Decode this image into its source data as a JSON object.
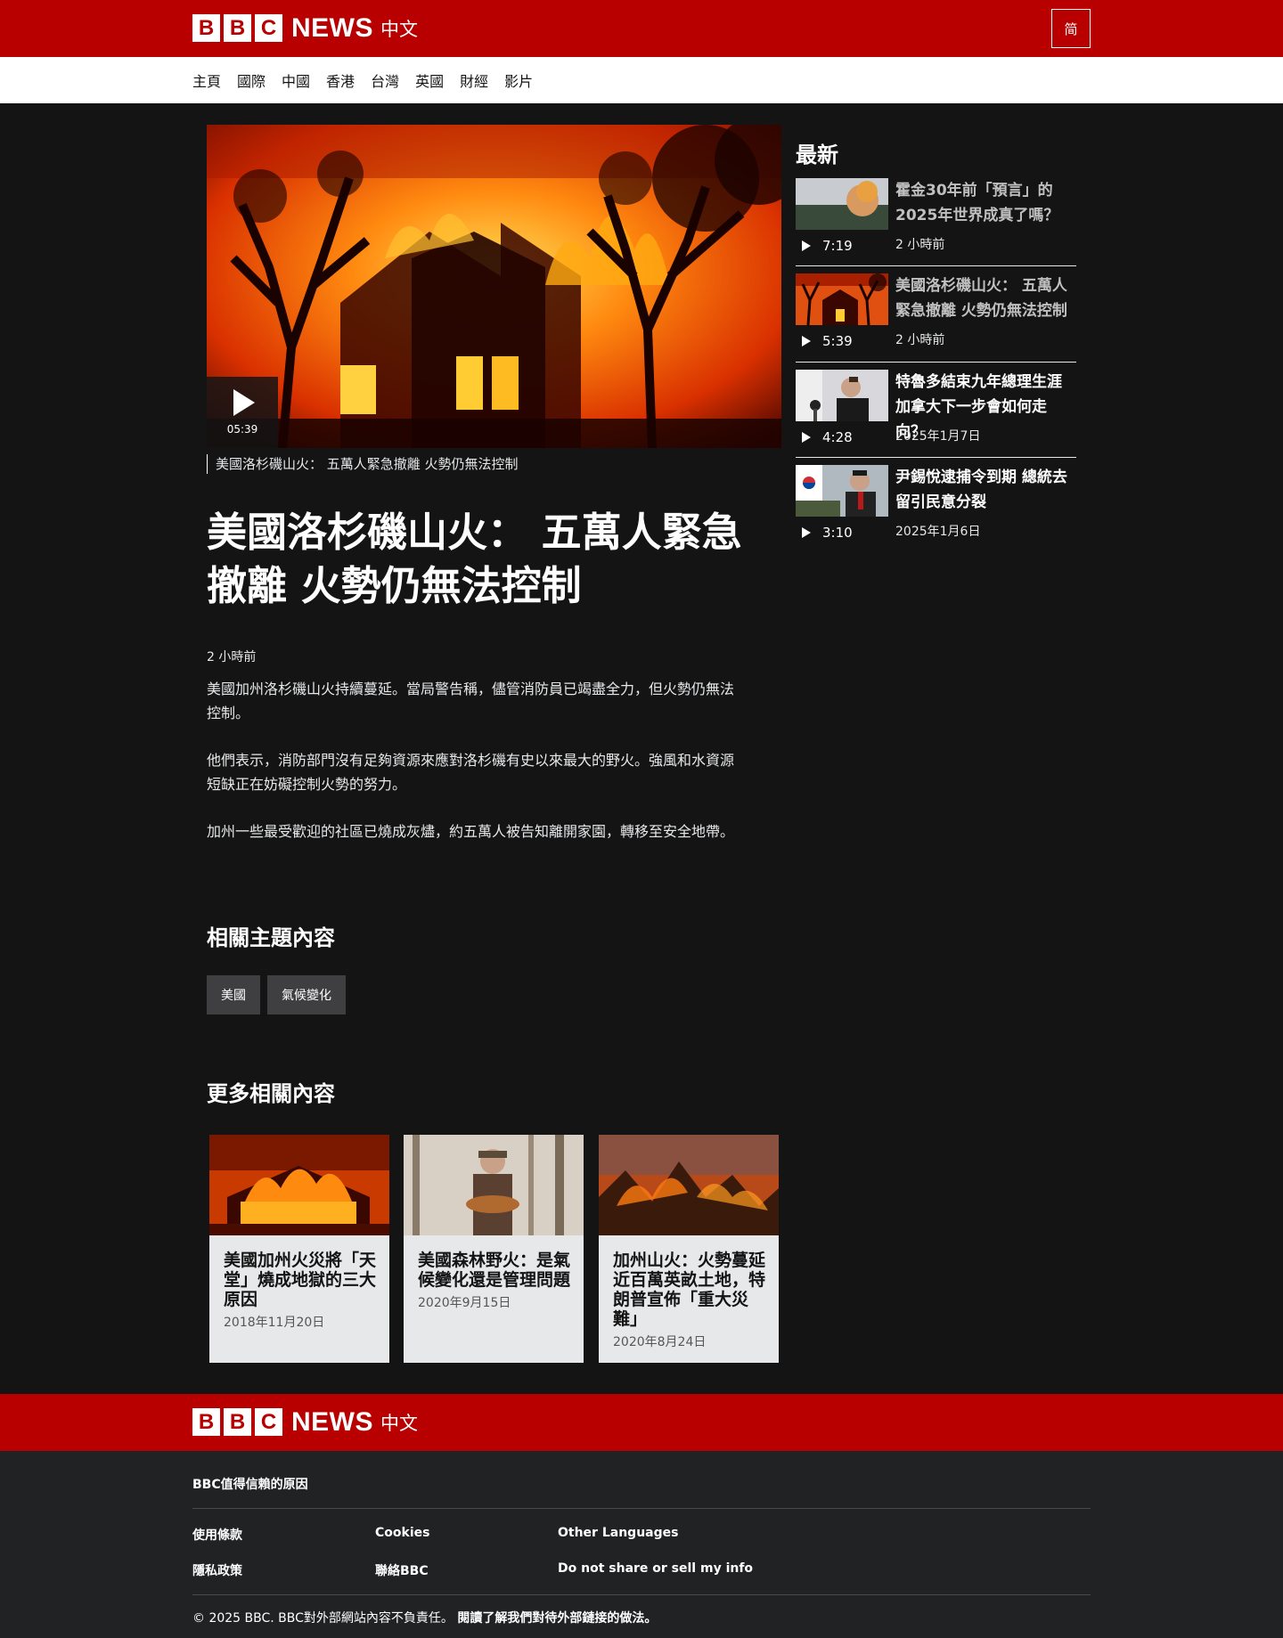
{
  "header": {
    "logo_letters": [
      "B",
      "B",
      "C"
    ],
    "logo_news": "NEWS",
    "logo_lang": "中文",
    "lang_toggle": "简"
  },
  "nav": [
    "主頁",
    "國際",
    "中國",
    "香港",
    "台灣",
    "英國",
    "財經",
    "影片"
  ],
  "hero": {
    "duration": "05:39",
    "caption": "美國洛杉磯山火： 五萬人緊急撤離 火勢仍無法控制"
  },
  "article": {
    "headline": "美國洛杉磯山火： 五萬人緊急撤離 火勢仍無法控制",
    "timestamp": "2 小時前",
    "paragraphs": [
      "美國加州洛杉磯山火持續蔓延。當局警告稱，儘管消防員已竭盡全力，但火勢仍無法控制。",
      "他們表示，消防部門沒有足夠資源來應對洛杉磯有史以來最大的野火。強風和水資源短缺正在妨礙控制火勢的努力。",
      "加州一些最受歡迎的社區已燒成灰燼，約五萬人被告知離開家園，轉移至安全地帶。"
    ]
  },
  "topics": {
    "title": "相關主題內容",
    "tags": [
      "美國",
      "氣候變化"
    ]
  },
  "related": {
    "title": "更多相關內容",
    "cards": [
      {
        "title": "美國加州火災將「天堂」燒成地獄的三大原因",
        "date": "2018年11月20日"
      },
      {
        "title": "美國森林野火：是氣候變化還是管理問題",
        "date": "2020年9月15日"
      },
      {
        "title": "加州山火：火勢蔓延近百萬英畝土地，特朗普宣佈「重大災難」",
        "date": "2020年8月24日"
      }
    ]
  },
  "sidebar": {
    "title": "最新",
    "items": [
      {
        "duration": "7:19",
        "title": "霍金30年前「預言」的2025年世界成真了嗎？",
        "time": "2 小時前"
      },
      {
        "duration": "5:39",
        "title": "美國洛杉磯山火： 五萬人緊急撤離 火勢仍無法控制",
        "time": "2 小時前"
      },
      {
        "duration": "4:28",
        "title": "特魯多結束九年總理生涯 加拿大下一步會如何走向？",
        "time": "2025年1月7日"
      },
      {
        "duration": "3:10",
        "title": "尹錫悅逮捕令到期 總統去留引民意分裂",
        "time": "2025年1月6日"
      }
    ]
  },
  "footer": {
    "trust": "BBC值得信賴的原因",
    "links": [
      "使用條款",
      "Cookies",
      "Other Languages",
      "隱私政策",
      "聯絡BBC",
      "Do not share or sell my info"
    ],
    "copyright": "© 2025 BBC. BBC對外部網站內容不負責任。",
    "external_link": "閱讀了解我們對待外部鏈接的做法。"
  },
  "colors": {
    "brand_red": "#b80000",
    "page_bg": "#141414",
    "footer_bg": "#202224"
  }
}
